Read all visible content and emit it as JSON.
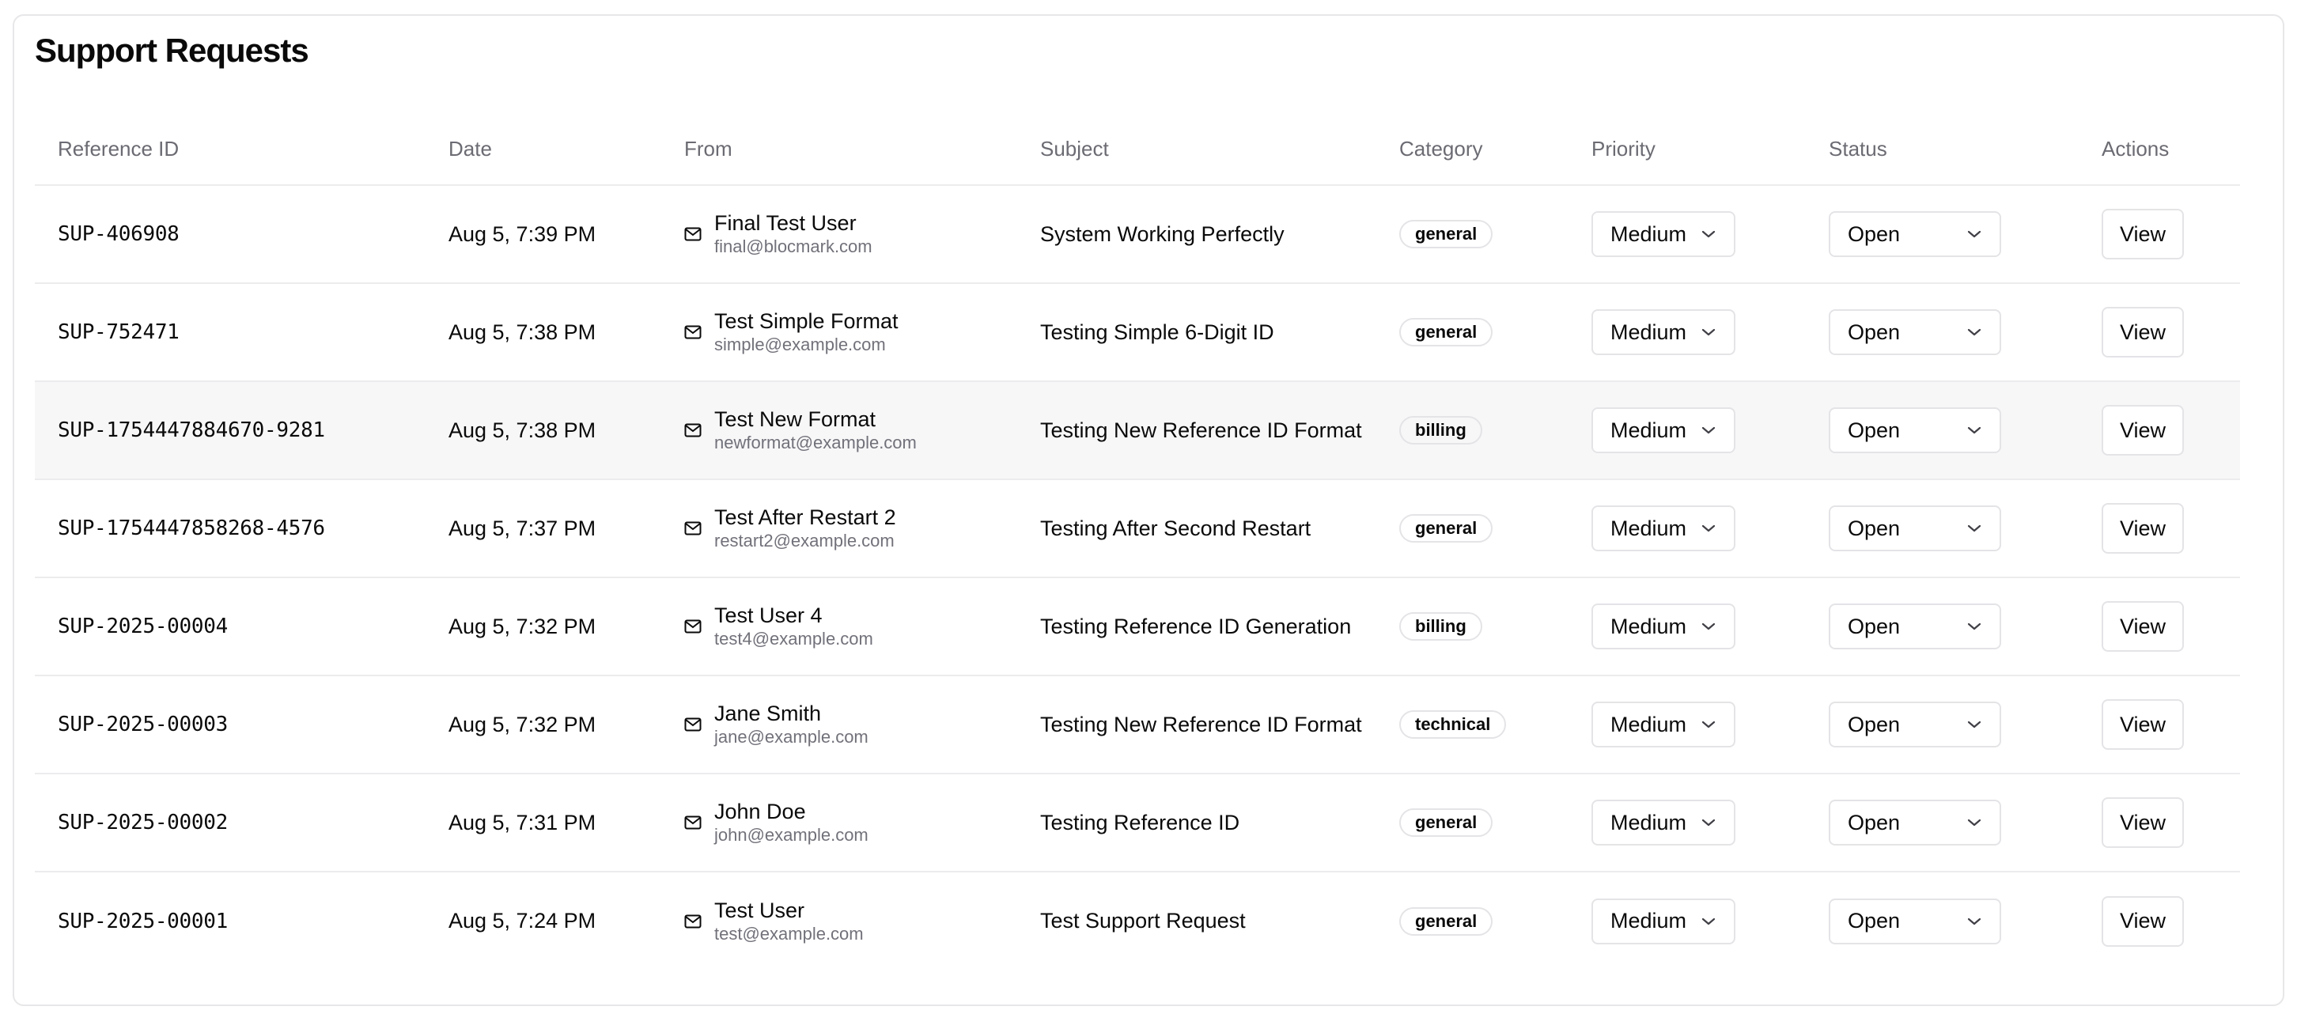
{
  "page": {
    "title": "Support Requests"
  },
  "columns": {
    "reference_id": "Reference ID",
    "date": "Date",
    "from": "From",
    "subject": "Subject",
    "category": "Category",
    "priority": "Priority",
    "status": "Status",
    "actions": "Actions"
  },
  "icons": {
    "from": "mail-icon",
    "select": "chevron-down-icon"
  },
  "rows": [
    {
      "ref": "SUP-406908",
      "date": "Aug 5, 7:39 PM",
      "name": "Final Test User",
      "email": "final@blocmark.com",
      "subject": "System Working Perfectly",
      "category": "general",
      "priority": "Medium",
      "status": "Open",
      "action": "View"
    },
    {
      "ref": "SUP-752471",
      "date": "Aug 5, 7:38 PM",
      "name": "Test Simple Format",
      "email": "simple@example.com",
      "subject": "Testing Simple 6-Digit ID",
      "category": "general",
      "priority": "Medium",
      "status": "Open",
      "action": "View"
    },
    {
      "ref": "SUP-1754447884670-9281",
      "date": "Aug 5, 7:38 PM",
      "name": "Test New Format",
      "email": "newformat@example.com",
      "subject": "Testing New Reference ID Format",
      "category": "billing",
      "priority": "Medium",
      "status": "Open",
      "action": "View"
    },
    {
      "ref": "SUP-1754447858268-4576",
      "date": "Aug 5, 7:37 PM",
      "name": "Test After Restart 2",
      "email": "restart2@example.com",
      "subject": "Testing After Second Restart",
      "category": "general",
      "priority": "Medium",
      "status": "Open",
      "action": "View"
    },
    {
      "ref": "SUP-2025-00004",
      "date": "Aug 5, 7:32 PM",
      "name": "Test User 4",
      "email": "test4@example.com",
      "subject": "Testing Reference ID Generation",
      "category": "billing",
      "priority": "Medium",
      "status": "Open",
      "action": "View"
    },
    {
      "ref": "SUP-2025-00003",
      "date": "Aug 5, 7:32 PM",
      "name": "Jane Smith",
      "email": "jane@example.com",
      "subject": "Testing New Reference ID Format",
      "category": "technical",
      "priority": "Medium",
      "status": "Open",
      "action": "View"
    },
    {
      "ref": "SUP-2025-00002",
      "date": "Aug 5, 7:31 PM",
      "name": "John Doe",
      "email": "john@example.com",
      "subject": "Testing Reference ID",
      "category": "general",
      "priority": "Medium",
      "status": "Open",
      "action": "View"
    },
    {
      "ref": "SUP-2025-00001",
      "date": "Aug 5, 7:24 PM",
      "name": "Test User",
      "email": "test@example.com",
      "subject": "Test Support Request",
      "category": "general",
      "priority": "Medium",
      "status": "Open",
      "action": "View"
    }
  ],
  "hovered_row_index": 2
}
